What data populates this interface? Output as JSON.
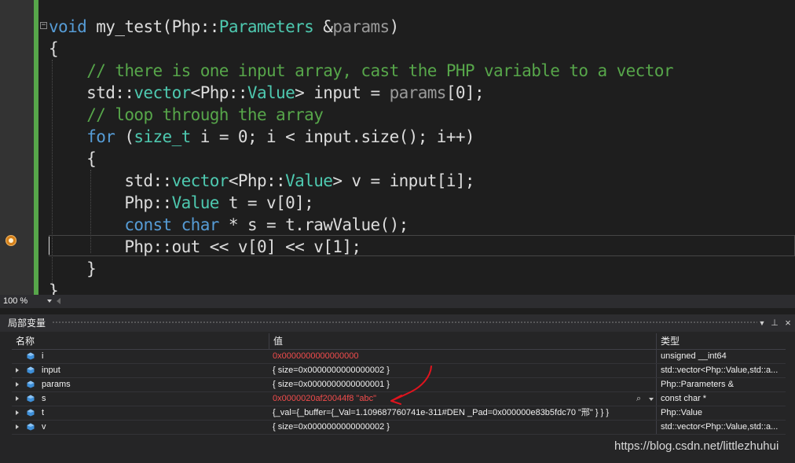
{
  "editor": {
    "lines": [
      [
        {
          "t": "void",
          "c": "kw"
        },
        {
          "t": " my_test(Php::"
        },
        {
          "t": "Parameters",
          "c": "ty"
        },
        {
          "t": " &"
        },
        {
          "t": "params",
          "c": "pr"
        },
        {
          "t": ")"
        }
      ],
      [
        {
          "t": "{"
        }
      ],
      [
        {
          "t": "    "
        },
        {
          "t": "// there is one input array, cast the PHP variable to a vector",
          "c": "cm"
        }
      ],
      [
        {
          "t": "    std::"
        },
        {
          "t": "vector",
          "c": "ty"
        },
        {
          "t": "<Php::"
        },
        {
          "t": "Value",
          "c": "ty"
        },
        {
          "t": "> input = "
        },
        {
          "t": "params",
          "c": "pr"
        },
        {
          "t": "[0];"
        }
      ],
      [
        {
          "t": "    "
        },
        {
          "t": "// loop through the array",
          "c": "cm"
        }
      ],
      [
        {
          "t": "    "
        },
        {
          "t": "for",
          "c": "kw"
        },
        {
          "t": " ("
        },
        {
          "t": "size_t",
          "c": "ty"
        },
        {
          "t": " i = 0; i < input.size(); i++)"
        }
      ],
      [
        {
          "t": "    {"
        }
      ],
      [
        {
          "t": "        std::"
        },
        {
          "t": "vector",
          "c": "ty"
        },
        {
          "t": "<Php::"
        },
        {
          "t": "Value",
          "c": "ty"
        },
        {
          "t": "> v = input[i];"
        }
      ],
      [
        {
          "t": "        Php::"
        },
        {
          "t": "Value",
          "c": "ty"
        },
        {
          "t": " t = v[0];"
        }
      ],
      [
        {
          "t": "        "
        },
        {
          "t": "const",
          "c": "kw"
        },
        {
          "t": " "
        },
        {
          "t": "char",
          "c": "kw"
        },
        {
          "t": " * s = t.rawValue();"
        }
      ],
      [
        {
          "t": "        Php::out << v[0] << v[1];"
        }
      ],
      [
        {
          "t": "    }"
        }
      ],
      [
        {
          "t": "}"
        }
      ]
    ]
  },
  "zoom": {
    "level": "100 %"
  },
  "locals": {
    "title": "局部变量",
    "columns": {
      "name": "名称",
      "value": "值",
      "type": "类型"
    },
    "rows": [
      {
        "name": "i",
        "value": "0x0000000000000000",
        "type": "unsigned __int64",
        "expandable": false,
        "changed": true
      },
      {
        "name": "input",
        "value": "{ size=0x0000000000000002 }",
        "type": "std::vector<Php::Value,std::a...",
        "expandable": true,
        "changed": false
      },
      {
        "name": "params",
        "value": "{ size=0x0000000000000001 }",
        "type": "Php::Parameters &",
        "expandable": true,
        "changed": false
      },
      {
        "name": "s",
        "value": "0x0000020af20044f8 \"abc\"",
        "type": "const char *",
        "expandable": true,
        "changed": true
      },
      {
        "name": "t",
        "value": "{_val={_buffer={_Val=1.109687760741e-311#DEN _Pad=0x000000e83b5fdc70 \"邢\" } } }",
        "type": "Php::Value",
        "expandable": true,
        "changed": false
      },
      {
        "name": "v",
        "value": "{ size=0x0000000000000002 }",
        "type": "std::vector<Php::Value,std::a...",
        "expandable": true,
        "changed": false
      }
    ]
  },
  "colors": {
    "changed_value": "#f14c4c",
    "annotation_arrow": "#e0141e",
    "change_bar": "#57a64a"
  },
  "icons": {
    "breakpoint": "current-statement-breakpoint-icon",
    "variable": "local-variable-icon",
    "search": "magnifier-icon"
  },
  "watermark": "https://blog.csdn.net/littlezhuhui"
}
